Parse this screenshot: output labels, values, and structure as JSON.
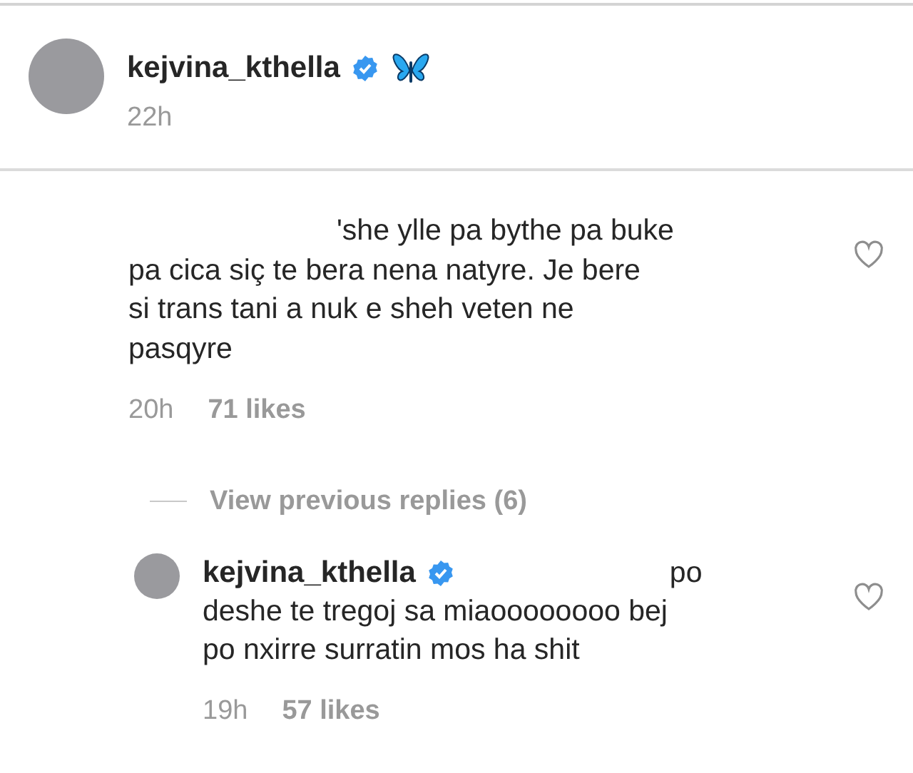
{
  "post": {
    "username": "kejvina_kthella",
    "verified": true,
    "time": "22h"
  },
  "comment": {
    "text": "'she ylle pa bythe pa buke\npa cica siç te bera nena natyre. Je bere\nsi trans tani a nuk e sheh veten ne\npasqyre",
    "time": "20h",
    "likes": "71 likes",
    "liked": false
  },
  "view_replies": "View previous replies (6)",
  "reply": {
    "username": "kejvina_kthella",
    "verified": true,
    "text_first_line": "po",
    "text": "deshe te tregoj sa miaoooooooo bej\npo nxirre surratin mos ha shit",
    "time": "19h",
    "likes": "57 likes",
    "liked": false
  }
}
